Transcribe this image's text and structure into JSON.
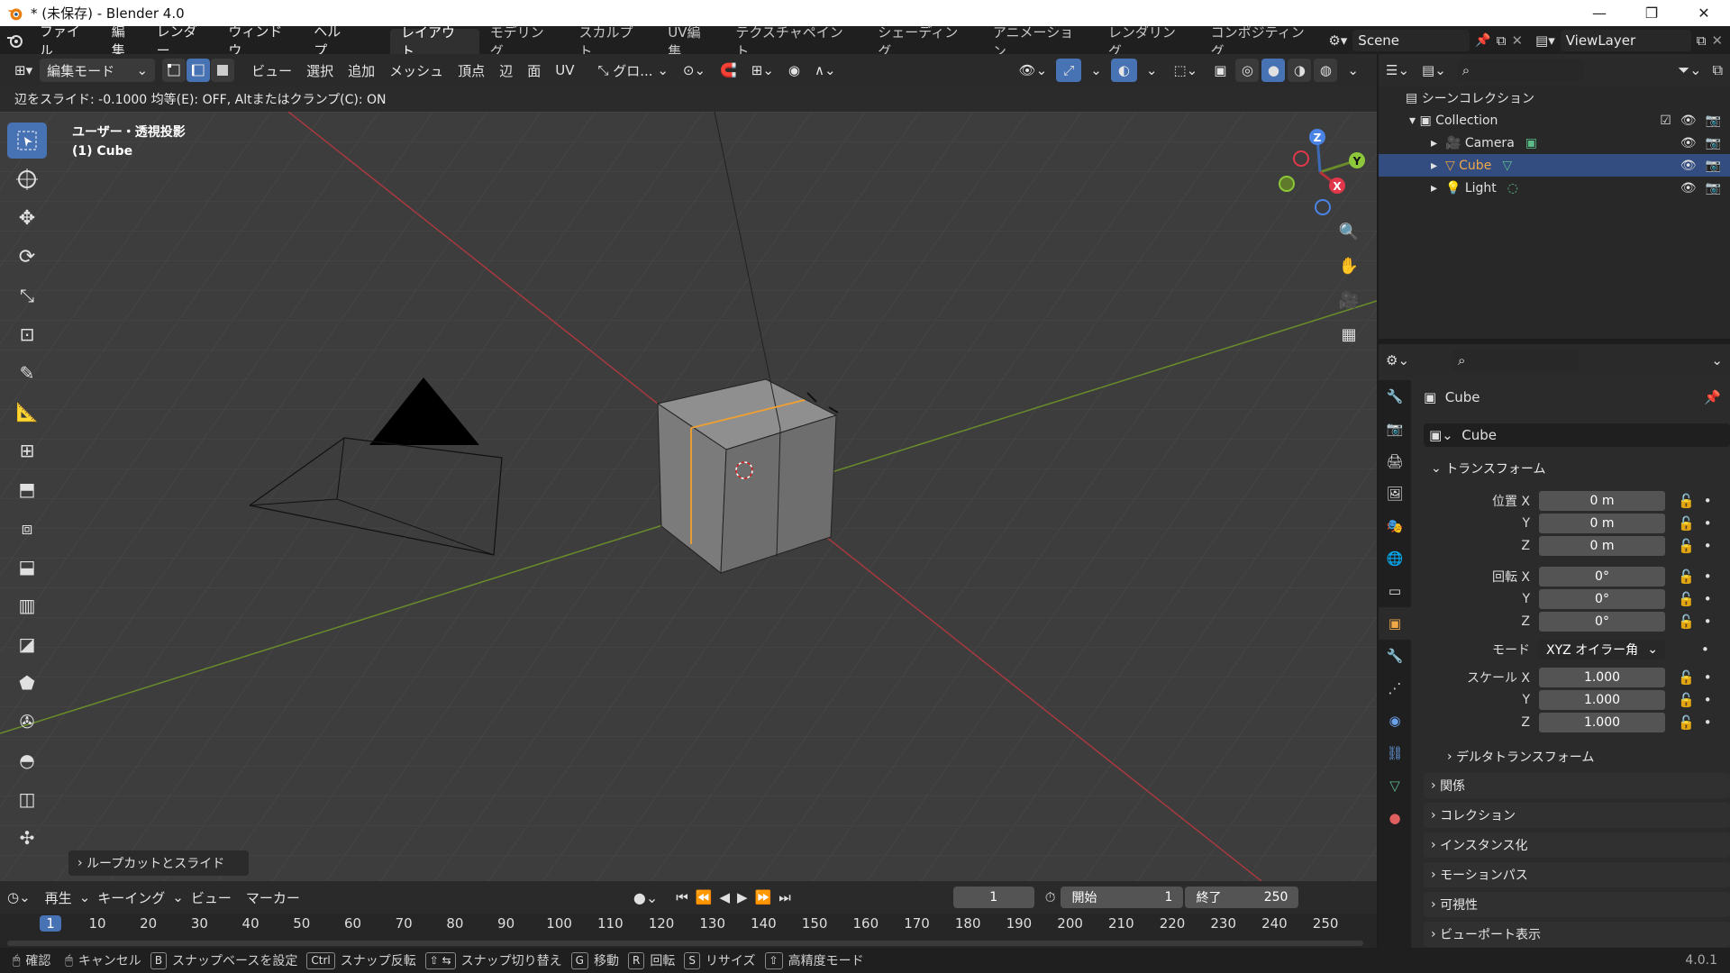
{
  "window": {
    "title": "* (未保存) - Blender 4.0",
    "min": "—",
    "max": "❐",
    "close": "✕"
  },
  "menu": [
    "ファイル",
    "編集",
    "レンダー",
    "ウィンドウ",
    "ヘルプ"
  ],
  "workspaces": [
    "レイアウト",
    "モデリング",
    "スカルプト",
    "UV編集",
    "テクスチャペイント",
    "シェーディング",
    "アニメーション",
    "レンダリング",
    "コンポジティング"
  ],
  "scene": {
    "name": "Scene",
    "view_layer": "ViewLayer"
  },
  "header3d": {
    "mode": "編集モード",
    "menus": [
      "ビュー",
      "選択",
      "追加",
      "メッシュ",
      "頂点",
      "辺",
      "面",
      "UV"
    ],
    "orientation": "グロ..."
  },
  "operator_status": "辺をスライド: -0.1000 均等(E): OFF,  Altまたはクランプ(C): ON",
  "viewport": {
    "view_name": "ユーザー・透視投影",
    "object_label": "(1) Cube",
    "last_operator": "ループカットとスライド",
    "gizmo": {
      "x": "X",
      "y": "Y",
      "z": "Z"
    }
  },
  "outliner": {
    "root": "シーンコレクション",
    "collection": "Collection",
    "items": [
      {
        "name": "Camera"
      },
      {
        "name": "Cube"
      },
      {
        "name": "Light"
      }
    ]
  },
  "properties": {
    "object_name": "Cube",
    "datablock": "Cube",
    "transform_title": "トランスフォーム",
    "location": {
      "label_x": "位置 X",
      "label_y": "Y",
      "label_z": "Z",
      "x": "0 m",
      "y": "0 m",
      "z": "0 m"
    },
    "rotation": {
      "label_x": "回転 X",
      "label_y": "Y",
      "label_z": "Z",
      "x": "0°",
      "y": "0°",
      "z": "0°"
    },
    "mode_label": "モード",
    "mode_value": "XYZ オイラー角",
    "scale": {
      "label_x": "スケール X",
      "label_y": "Y",
      "label_z": "Z",
      "x": "1.000",
      "y": "1.000",
      "z": "1.000"
    },
    "delta": "デルタトランスフォーム",
    "panels": [
      "関係",
      "コレクション",
      "インスタンス化",
      "モーションパス",
      "可視性",
      "ビューポート表示"
    ]
  },
  "timeline": {
    "menus": [
      "再生",
      "キーイング",
      "ビュー",
      "マーカー"
    ],
    "current_frame": "1",
    "start_label": "開始",
    "start": "1",
    "end_label": "終了",
    "end": "250",
    "ruler": [
      "1",
      "10",
      "20",
      "30",
      "40",
      "50",
      "60",
      "70",
      "80",
      "90",
      "100",
      "110",
      "120",
      "130",
      "140",
      "150",
      "160",
      "170",
      "180",
      "190",
      "200",
      "210",
      "220",
      "230",
      "240",
      "250"
    ]
  },
  "statusbar": {
    "confirm": "確認",
    "cancel": "キャンセル",
    "b_key": "B",
    "snap_base": "スナップベースを設定",
    "ctrl_key": "Ctrl",
    "snap_invert": "スナップ反転",
    "snap_toggle": "スナップ切り替え",
    "g_key": "G",
    "move": "移動",
    "r_key": "R",
    "rotate": "回転",
    "s_key": "S",
    "resize": "リサイズ",
    "precision": "高精度モード",
    "version": "4.0.1"
  }
}
